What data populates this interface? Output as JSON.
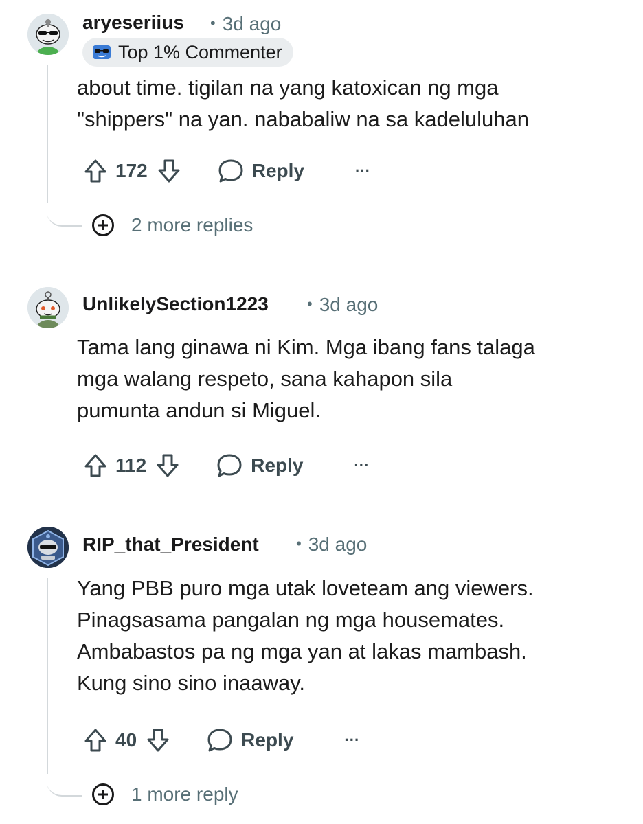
{
  "comments": [
    {
      "username": "aryeseriius",
      "separator": "•",
      "time": "3d ago",
      "badge": {
        "icon": "sunglasses-badge-icon",
        "label": "Top 1% Commenter"
      },
      "lines": [
        "about time. tigilan na yang katoxican ng mga",
        "\"shippers\" na yan. nababaliw na sa kadeluluhan"
      ],
      "votes": "172",
      "reply_label": "Reply",
      "more_label": "···",
      "more_replies": "2 more replies"
    },
    {
      "username": "UnlikelySection1223",
      "separator": "•",
      "time": "3d ago",
      "lines": [
        "Tama lang ginawa ni Kim. Mga ibang fans talaga",
        "mga walang respeto, sana kahapon sila",
        "pumunta andun si Miguel."
      ],
      "votes": "112",
      "reply_label": "Reply",
      "more_label": "···"
    },
    {
      "username": "RIP_that_President",
      "separator": "•",
      "time": "3d ago",
      "lines": [
        "Yang PBB puro mga utak loveteam ang viewers.",
        "Pinagsasama pangalan ng mga housemates.",
        "Ambabastos pa ng mga yan at lakas mambash.",
        "Kung sino sino inaaway."
      ],
      "votes": "40",
      "reply_label": "Reply",
      "more_label": "···",
      "more_replies": "1 more reply"
    }
  ],
  "colors": {
    "text": "#1c1c1c",
    "meta": "#576f76",
    "badge_bg": "#eaedef",
    "thread_line": "#d3d8db"
  }
}
